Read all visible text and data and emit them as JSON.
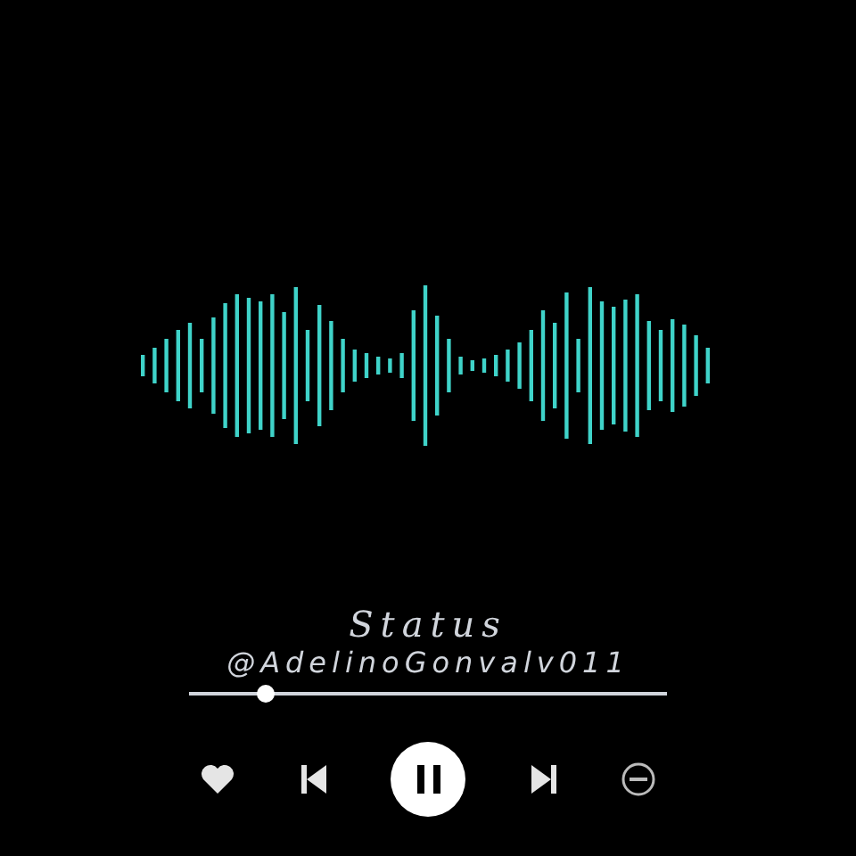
{
  "title": "Status",
  "artist": "@AdelinoGonvalv011",
  "progress": {
    "level": 0.16
  },
  "controls": [
    {
      "kind": "like"
    },
    {
      "kind": "previous"
    },
    {
      "kind": "pause"
    },
    {
      "kind": "next"
    },
    {
      "kind": "remove"
    }
  ]
}
